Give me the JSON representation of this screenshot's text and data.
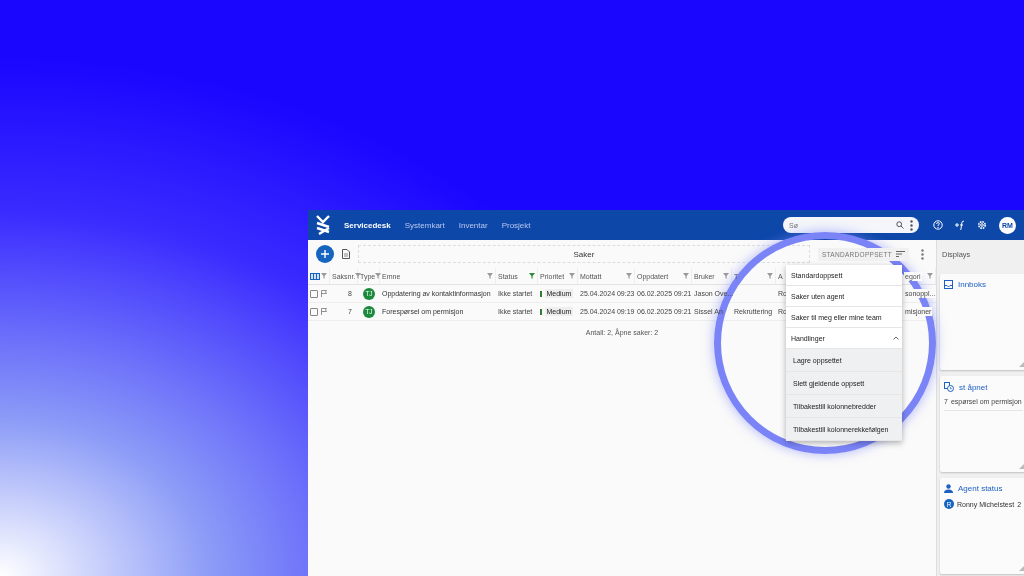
{
  "nav": {
    "items": [
      {
        "label": "Servicedesk",
        "selected": true
      },
      {
        "label": "Systemkart",
        "selected": false
      },
      {
        "label": "Inventar",
        "selected": false
      },
      {
        "label": "Prosjekt",
        "selected": false
      }
    ],
    "search": {
      "placeholder": "Sø"
    },
    "avatar": "RM"
  },
  "toolbar": {
    "title": "Saker",
    "layout_button": "STANDARDOPPSETT"
  },
  "table": {
    "columns": [
      {
        "label": "Saksnr.",
        "filtered": false
      },
      {
        "label": "Type",
        "filtered": false
      },
      {
        "label": "Emne",
        "filtered": false
      },
      {
        "label": "Status",
        "filtered": true
      },
      {
        "label": "Prioritet",
        "filtered": false
      },
      {
        "label": "Mottatt",
        "filtered": false
      },
      {
        "label": "Oppdatert",
        "filtered": false
      },
      {
        "label": "Bruker",
        "filtered": false
      },
      {
        "label": "T",
        "filtered": false
      },
      {
        "label": "A"
      },
      {
        "label": "egori",
        "filtered": false
      }
    ],
    "rows": [
      {
        "checked": false,
        "number": "8",
        "type": "TJ",
        "subject": "Oppdatering av kontaktinformasjon",
        "status": "Ikke startet",
        "priority": "Medium",
        "received": "25.04.2024 09:23",
        "updated": "06.02.2025 09:21",
        "user": "Jason Ove...",
        "column_10": "Ro",
        "category": "sonoppl..."
      },
      {
        "checked": false,
        "number": "7",
        "type": "TJ",
        "subject": "Forespørsel om permisjon",
        "status": "Ikke startet",
        "priority": "Medium",
        "received": "25.04.2024 09:19",
        "updated": "06.02.2025 09:21",
        "user": "Sissel An",
        "team": "Rekruttering",
        "column_10": "Ro",
        "category": "misjoner"
      }
    ],
    "footer": "Antall: 2, Åpne saker: 2"
  },
  "menu": {
    "items": [
      "Standardoppsett",
      "Saker uten agent",
      "Saker til meg eller mine team"
    ],
    "section": {
      "label": "Handlinger",
      "expanded": true,
      "items": [
        "Lagre oppsettet",
        "Slett gjeldende oppsett",
        "Tilbakestill kolonnebredder",
        "Tilbakestill kolonnerekkefølgen"
      ]
    }
  },
  "sidebar": {
    "title": "Displays",
    "panels": [
      {
        "kind": "inbox",
        "title": "Innboks"
      },
      {
        "kind": "recent",
        "title": "st åpnet",
        "rows": [
          {
            "number": "7",
            "subject": "espørsel om permisjon"
          }
        ]
      },
      {
        "kind": "agents",
        "title": "Agent status",
        "agents": [
          {
            "initial": "R",
            "name": "Ronny Michelstest",
            "count": "2"
          }
        ]
      }
    ]
  }
}
